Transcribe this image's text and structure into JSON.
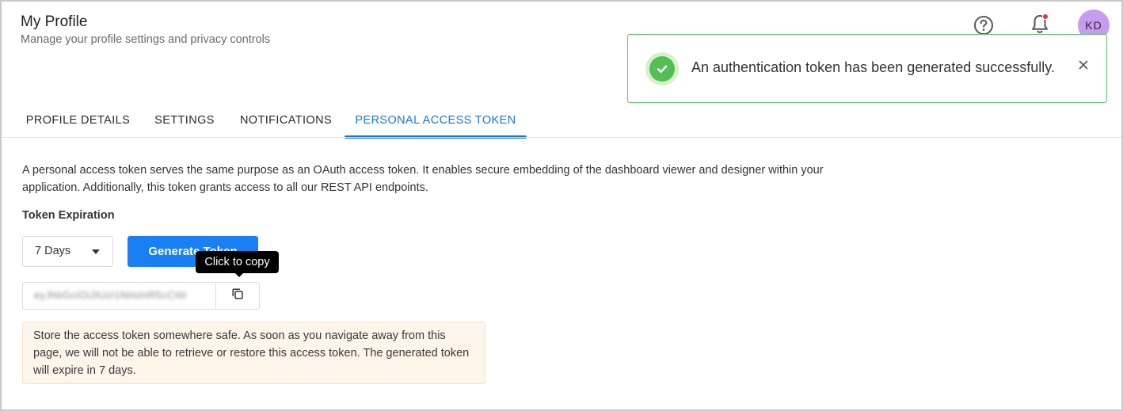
{
  "header": {
    "title": "My Profile",
    "subtitle": "Manage your profile settings and privacy controls",
    "avatar_initials": "KD",
    "help_icon": "help-circle-icon",
    "notification_icon": "bell-icon",
    "notification_dot_color": "#e8323c",
    "avatar_color": "#c79cf0"
  },
  "toast": {
    "message": "An authentication token has been generated successfully.",
    "status_icon": "check-circle-icon",
    "close_icon": "close-icon",
    "accent_color": "#52be55"
  },
  "tabs": [
    {
      "label": "PROFILE DETAILS",
      "active": false
    },
    {
      "label": "SETTINGS",
      "active": false
    },
    {
      "label": "NOTIFICATIONS",
      "active": false
    },
    {
      "label": "PERSONAL ACCESS TOKEN",
      "active": true
    }
  ],
  "content": {
    "description": "A personal access token serves the same purpose as an OAuth access token. It enables secure embedding of the dashboard viewer and designer within your application. Additionally, this token grants access to all our REST API endpoints.",
    "expiration_label": "Token Expiration",
    "expiration_selected": "7 Days",
    "generate_button": "Generate Token",
    "tooltip": "Click to copy",
    "token_value": "eyJhbGciOiJIUzI1NiIsInR5cCI6I",
    "copy_icon": "copy-icon",
    "warning": "Store the access token somewhere safe. As soon as you navigate away from this page, we will not be able to retrieve or restore this access token. The generated token will expire in 7 days.",
    "accent_color": "#1b74e4"
  }
}
